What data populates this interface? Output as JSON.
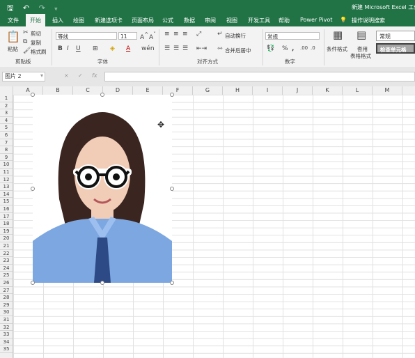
{
  "titlebar": {
    "save_icon": "save-icon",
    "undo_icon": "undo-icon",
    "redo_icon": "redo-icon",
    "title": "新建 Microsoft Excel 工作表"
  },
  "tabs": [
    "文件",
    "开始",
    "插入",
    "绘图",
    "新建选项卡",
    "页面布局",
    "公式",
    "数据",
    "审阅",
    "视图",
    "开发工具",
    "帮助",
    "Power Pivot",
    "操作说明搜索"
  ],
  "ribbon": {
    "clipboard": {
      "paste": "粘贴",
      "cut": "剪切",
      "copy": "复制",
      "format_painter": "格式刷",
      "label": "剪贴板"
    },
    "font": {
      "name": "等线",
      "size": "11",
      "label": "字体",
      "bold": "B",
      "italic": "I",
      "underline": "U"
    },
    "alignment": {
      "wrap": "自动换行",
      "merge": "合并后居中",
      "label": "对齐方式"
    },
    "number": {
      "format": "常规",
      "percent": "%",
      "comma": ",",
      "label": "数字"
    },
    "styles": {
      "conditional": "条件格式",
      "table": "套用",
      "table2": "表格格式",
      "normal": "常规",
      "check_cell": "检查单元格"
    }
  },
  "formula_bar": {
    "name_box": "图片 2",
    "cancel": "×",
    "enter": "✓",
    "fx": "fx",
    "value": ""
  },
  "columns": [
    "A",
    "B",
    "C",
    "D",
    "E",
    "F",
    "G",
    "H",
    "I",
    "J",
    "K",
    "L",
    "M"
  ],
  "rows": [
    "1",
    "2",
    "3",
    "4",
    "5",
    "6",
    "7",
    "8",
    "9",
    "10",
    "11",
    "12",
    "13",
    "14",
    "15",
    "16",
    "17",
    "18",
    "19",
    "20",
    "21",
    "22",
    "23",
    "24",
    "25",
    "26",
    "27",
    "28",
    "29",
    "30",
    "31",
    "32",
    "33",
    "34",
    "35"
  ],
  "colors": {
    "excel_green": "#217346",
    "shirt_blue": "#7da7e0",
    "tie_navy": "#2d4a86"
  },
  "cursor_icon": "move-cursor-icon"
}
